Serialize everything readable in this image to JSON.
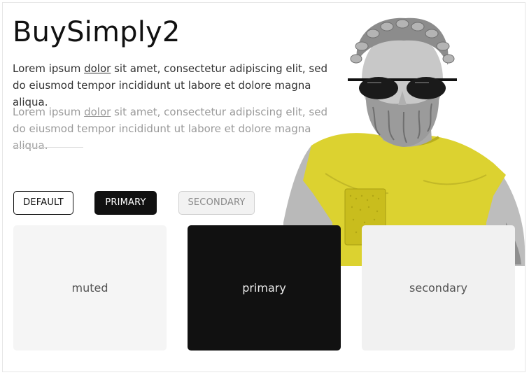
{
  "header": {
    "title": "BuySimply2"
  },
  "content": {
    "paragraph_1": {
      "before": "Lorem ipsum ",
      "link": "dolor",
      "after": " sit amet, consectetur adipiscing elit, sed do eiusmod tempor incididunt ut labore et dolore magna aliqua."
    },
    "paragraph_2": {
      "before": "Lorem ipsum ",
      "link": "dolor",
      "after": " sit amet, consectetur adipiscing elit, sed do eiusmod tempor incididunt ut labore et dolore magna aliqua."
    }
  },
  "buttons": {
    "default_label": "DEFAULT",
    "primary_label": "PRIMARY",
    "secondary_label": "SECONDARY"
  },
  "cards": {
    "muted_label": "muted",
    "primary_label": "primary",
    "secondary_label": "secondary"
  },
  "image": {
    "icon": "statue-with-sunglasses-image"
  },
  "colors": {
    "primary": "#111111",
    "muted_bg": "#f5f5f5",
    "secondary_bg": "#f1f1f1",
    "shirt_yellow": "#e2d83a"
  }
}
